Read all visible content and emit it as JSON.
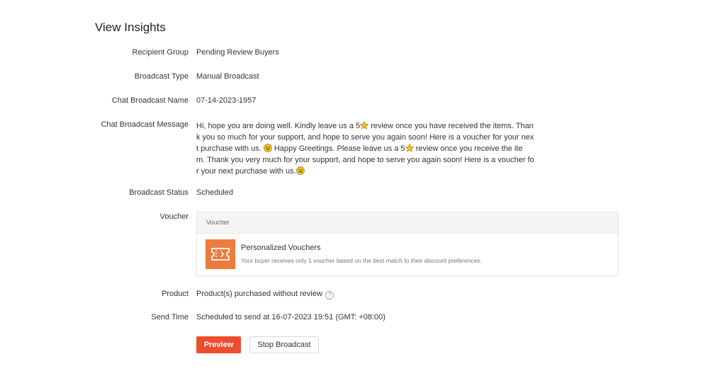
{
  "page": {
    "title": "View Insights"
  },
  "fields": {
    "recipient_group": {
      "label": "Recipient Group",
      "value": "Pending Review Buyers"
    },
    "broadcast_type": {
      "label": "Broadcast Type",
      "value": "Manual Broadcast"
    },
    "chat_broadcast_name": {
      "label": "Chat Broadcast Name",
      "value": "07-14-2023-1957"
    },
    "chat_broadcast_message": {
      "label": "Chat Broadcast Message",
      "lines": [
        [
          "Hi, hope you are doing well. Kindly leave us a 5",
          "star-emoji",
          " review once you have received the items. Than"
        ],
        [
          "k you so much for your support, and hope to serve you again soon! Here is a voucher for your nex"
        ],
        [
          "t purchase with us. ",
          "grinning-emoji",
          " Happy Greetings. Please leave us a 5",
          "star-emoji",
          " review once you receive the ite"
        ],
        [
          "m. Thank you very much for your support, and hope to serve you again soon! Here is a voucher fo"
        ],
        [
          "r your next purchase with us.",
          "grinning-emoji"
        ]
      ]
    },
    "broadcast_status": {
      "label": "Broadcast Status",
      "value": "Scheduled"
    },
    "voucher": {
      "label": "Voucher",
      "header": "Voucher",
      "name": "Personalized Vouchers",
      "description": "Your buyer receives only 1 voucher based on the best match to their discount preferences."
    },
    "product": {
      "label": "Product",
      "value": "Product(s) purchased without review",
      "help": "?"
    },
    "send_time": {
      "label": "Send Time",
      "value": "Scheduled to send at 16-07-2023 19:51 (GMT: +08:00)"
    }
  },
  "actions": {
    "preview_label": "Preview",
    "stop_label": "Stop Broadcast"
  },
  "colors": {
    "accent": "#ee4d2d",
    "voucher_icon_bg": "#ee7a3d"
  }
}
